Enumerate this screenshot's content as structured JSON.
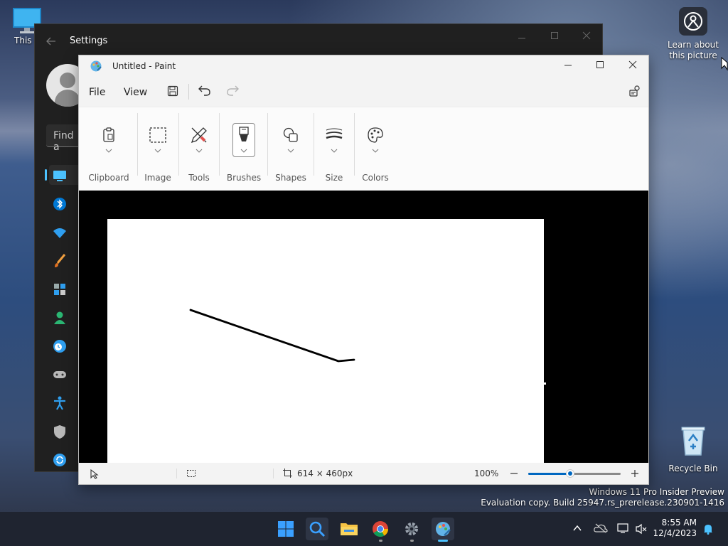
{
  "desktop": {
    "this_pc_label": "This PC",
    "recycle_bin_label": "Recycle Bin",
    "learn_label": "Learn about this picture",
    "watermark_line1": "Windows 11 Pro Insider Preview",
    "watermark_line2": "Evaluation copy. Build 25947.rs_prerelease.230901-1416"
  },
  "settings": {
    "title": "Settings",
    "search_placeholder": "Find a"
  },
  "paint": {
    "title": "Untitled - Paint",
    "menu": {
      "file": "File",
      "view": "View"
    },
    "ribbon": {
      "clipboard": "Clipboard",
      "image": "Image",
      "tools": "Tools",
      "brushes": "Brushes",
      "shapes": "Shapes",
      "size": "Size",
      "colors": "Colors"
    },
    "status": {
      "canvas_size": "614 × 460px",
      "zoom": "100%",
      "zoom_fraction": 0.45
    }
  },
  "taskbar": {
    "time": "8:55 AM",
    "date": "12/4/2023"
  },
  "colors": {
    "accent": "#0067c0",
    "paint_canvas": "#ffffff",
    "workspace": "#000000",
    "settings_bg": "#202020"
  }
}
